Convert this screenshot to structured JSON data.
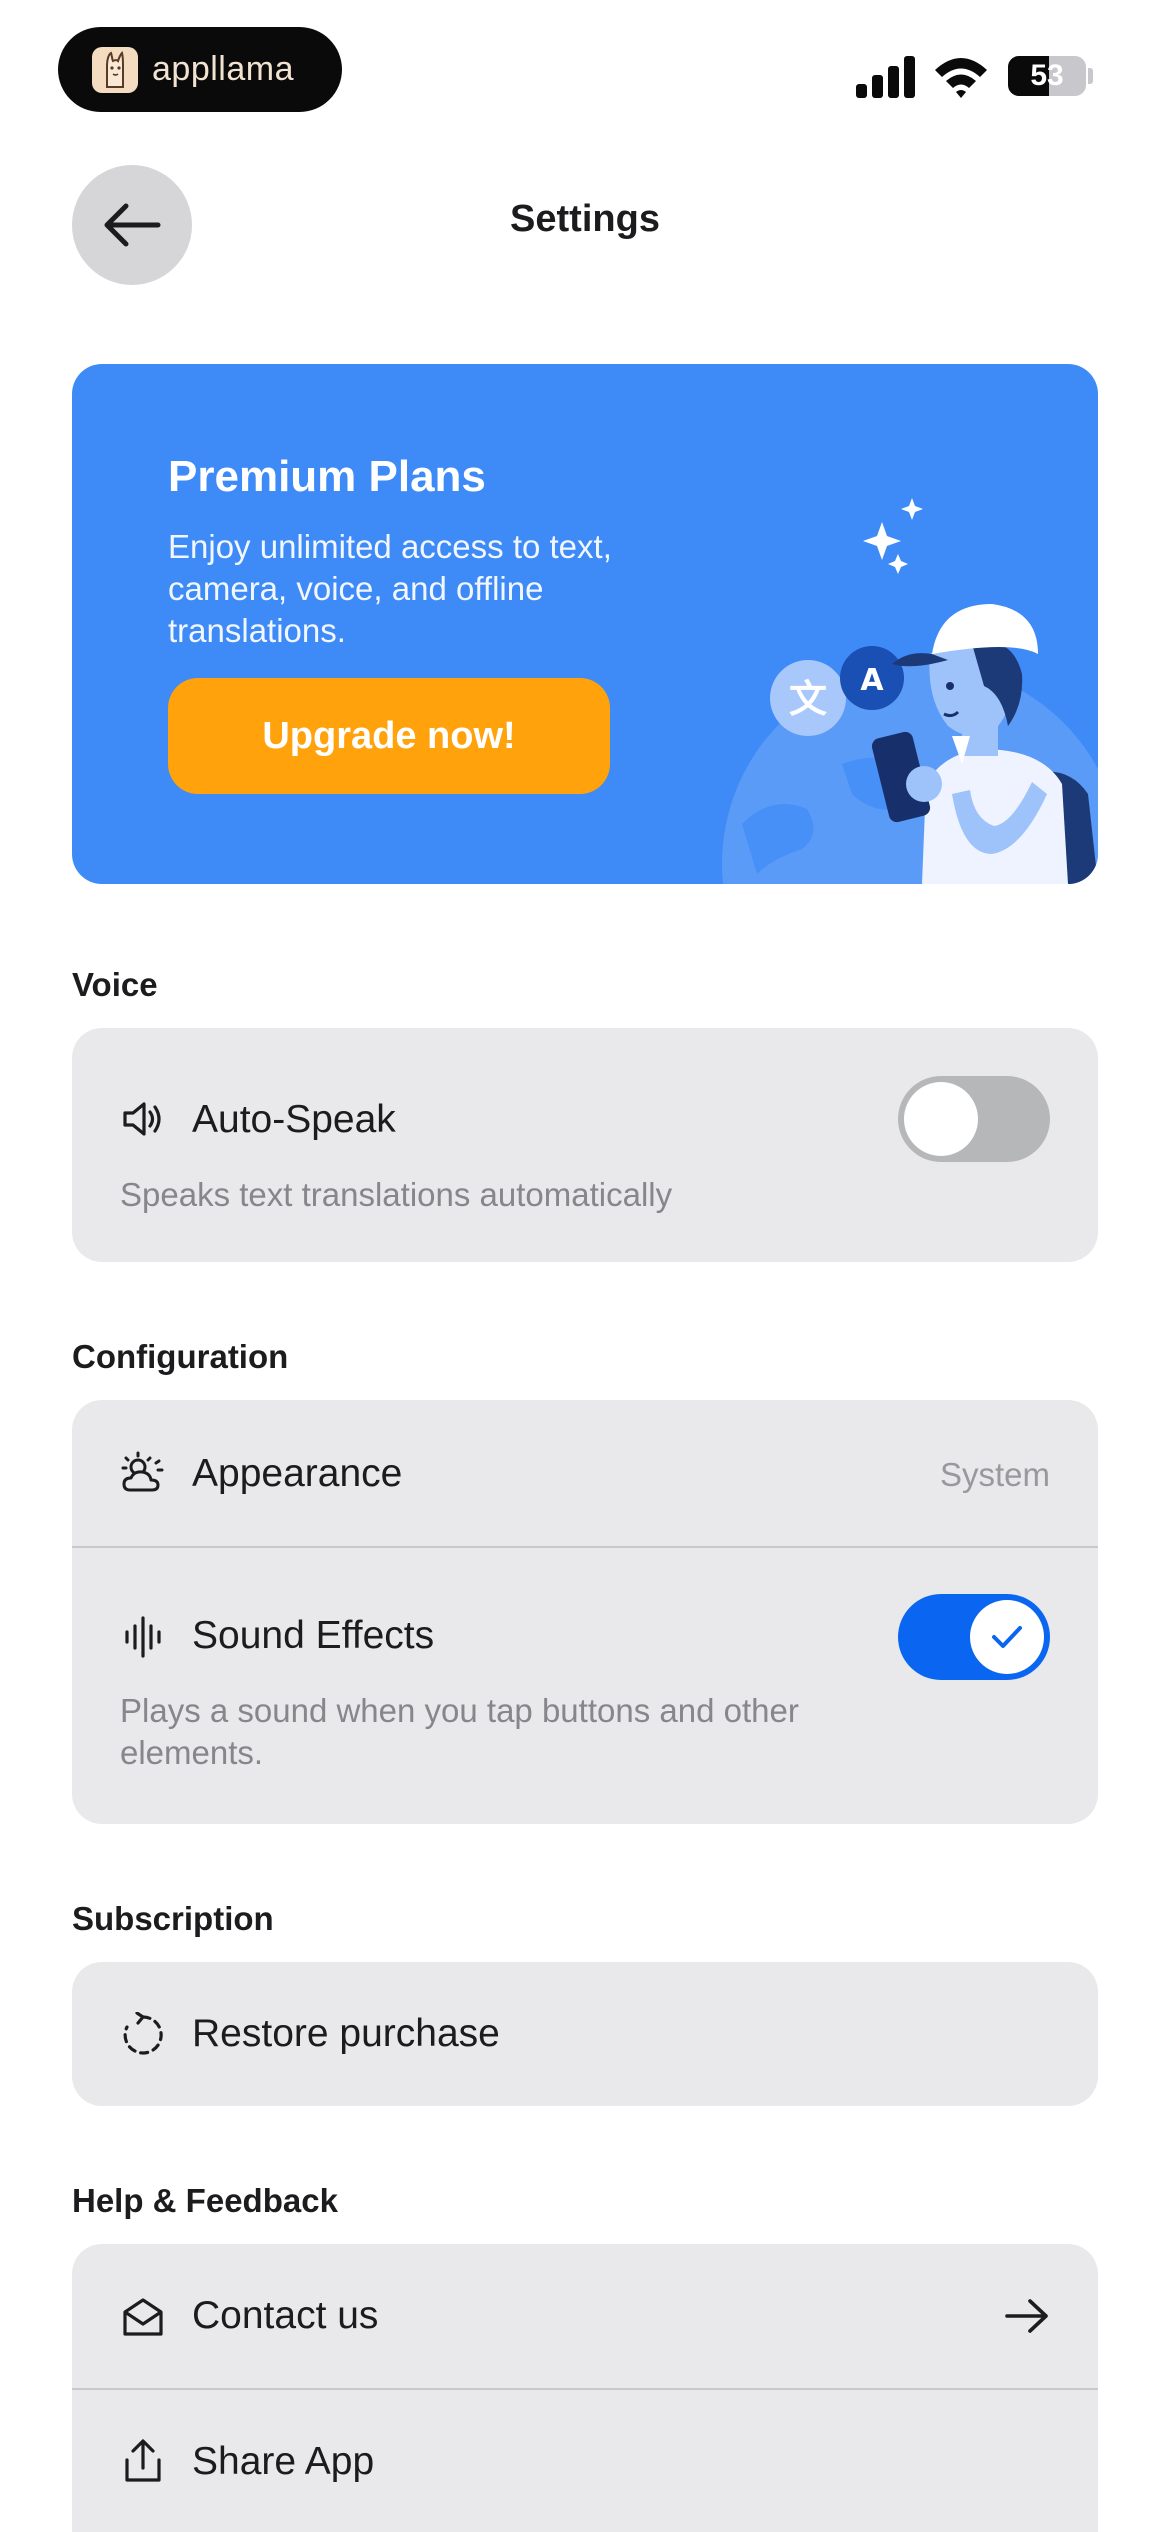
{
  "status_bar": {
    "app_name": "appllama",
    "battery_level": "53",
    "battery_percent": 53
  },
  "header": {
    "title": "Settings",
    "back_icon": "arrow-left-icon"
  },
  "premium": {
    "title": "Premium Plans",
    "description": "Enjoy unlimited access to text, camera, voice, and offline translations.",
    "button_label": "Upgrade now!",
    "badge_letter": "A",
    "colors": {
      "card": "#3e8bf7",
      "button": "#ffa20b"
    }
  },
  "voice": {
    "section_label": "Voice",
    "auto_speak": {
      "icon": "speaker-icon",
      "label": "Auto-Speak",
      "description": "Speaks text translations automatically",
      "enabled": false
    }
  },
  "configuration": {
    "section_label": "Configuration",
    "appearance": {
      "icon": "sun-cloud-icon",
      "label": "Appearance",
      "value": "System"
    },
    "sound_effects": {
      "icon": "sound-wave-icon",
      "label": "Sound Effects",
      "description": "Plays a sound when you tap buttons and other elements.",
      "enabled": true
    }
  },
  "subscription": {
    "section_label": "Subscription",
    "restore": {
      "icon": "restore-icon",
      "label": "Restore purchase"
    }
  },
  "help": {
    "section_label": "Help & Feedback",
    "contact": {
      "icon": "envelope-open-icon",
      "label": "Contact us",
      "action_icon": "arrow-right-icon"
    },
    "share": {
      "icon": "share-icon",
      "label": "Share App"
    }
  },
  "colors": {
    "accent": "#0a66f0",
    "group_background": "#e9e9eb",
    "secondary_text": "#86868b"
  }
}
